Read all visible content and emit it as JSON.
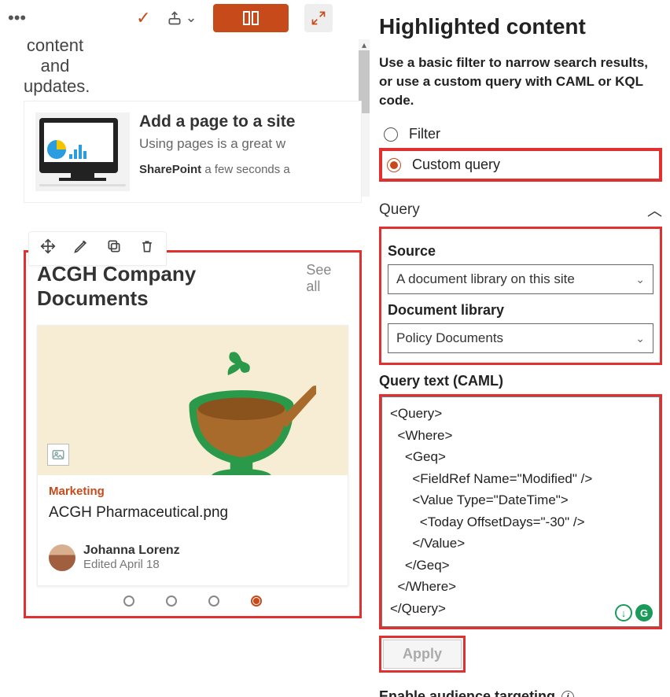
{
  "toolbar": {
    "columns_icon": "columns",
    "collapse_icon": "collapse"
  },
  "sidebar_text": {
    "line1": "content",
    "line2": "and",
    "line3": "updates."
  },
  "news": {
    "title": "Add a page to a site",
    "body": "Using pages is a great w",
    "source": "SharePoint",
    "time": "a few seconds a"
  },
  "editor_bar": {
    "move": "move",
    "edit": "edit",
    "copy": "copy",
    "delete": "delete"
  },
  "hc": {
    "title": "ACGH Company Documents",
    "see_all": "See all",
    "category": "Marketing",
    "doc_title": "ACGH Pharmaceutical.png",
    "author": "Johanna Lorenz",
    "edited": "Edited April 18"
  },
  "panel": {
    "title": "Highlighted content",
    "desc": "Use a basic filter to narrow search results, or use a custom query with CAML or KQL code.",
    "filter_label": "Filter",
    "custom_label": "Custom query",
    "query_section": "Query",
    "source_label": "Source",
    "source_value": "A document library on this site",
    "lib_label": "Document library",
    "lib_value": "Policy Documents",
    "caml_label": "Query text (CAML)",
    "caml_text": "<Query>\n  <Where>\n    <Geq>\n      <FieldRef Name=\"Modified\" />\n      <Value Type=\"DateTime\">\n        <Today OffsetDays=\"-30\" />\n      </Value>\n    </Geq>\n  </Where>\n</Query>",
    "apply": "Apply",
    "audience": "Enable audience targeting"
  }
}
